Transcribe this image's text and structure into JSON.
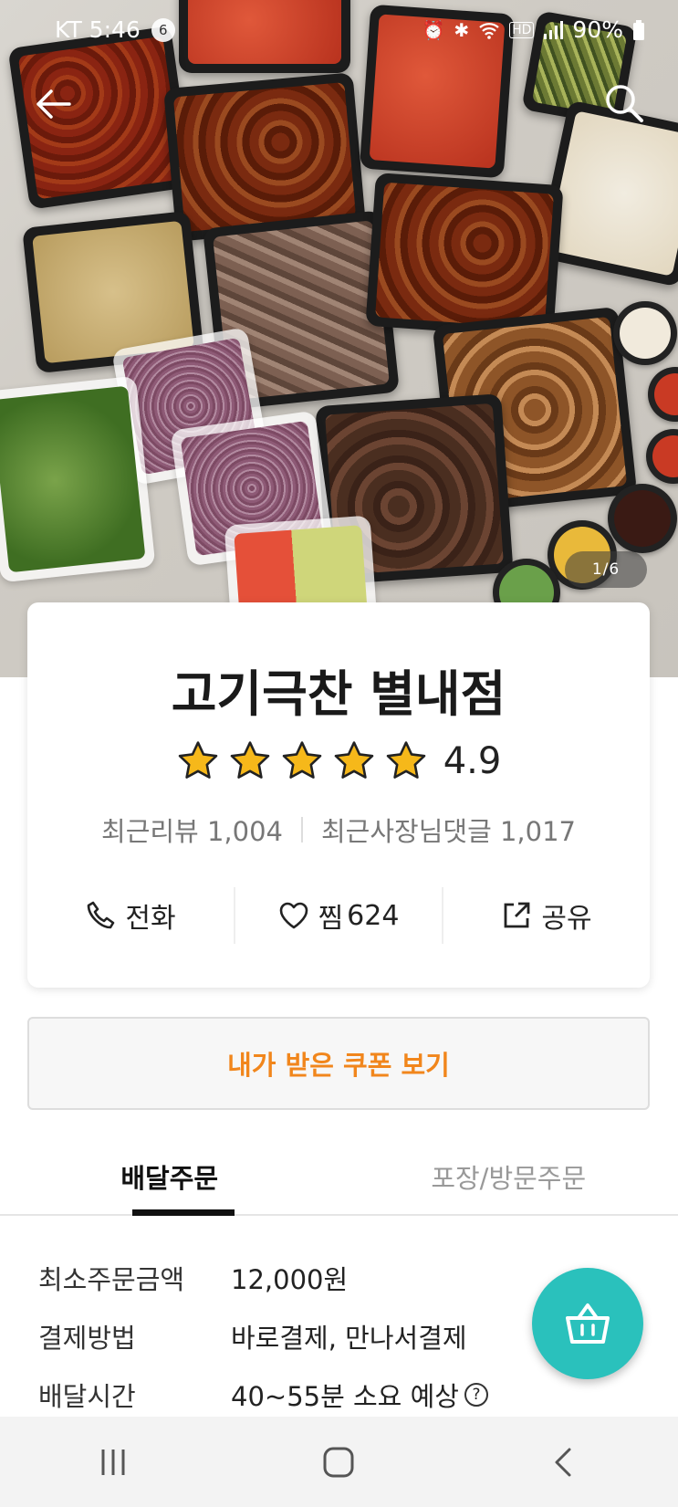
{
  "status_bar": {
    "carrier_time": "KT 5:46",
    "notification_count": "6",
    "icons": [
      "alarm-icon",
      "bluetooth-icon",
      "wifi-icon",
      "hd-icon",
      "signal-icon"
    ],
    "battery": "90%"
  },
  "hero": {
    "image_counter": "1/6"
  },
  "store": {
    "name": "고기극찬 별내점",
    "rating": "4.9",
    "star_count": 5,
    "recent_reviews": "최근리뷰 1,004",
    "recent_owner_replies": "최근사장님댓글 1,017"
  },
  "actions": {
    "call_label": "전화",
    "like_label": "찜",
    "like_count": "624",
    "share_label": "공유"
  },
  "coupon": {
    "label": "내가 받은 쿠폰 보기"
  },
  "tabs": {
    "delivery": "배달주문",
    "pickup": "포장/방문주문"
  },
  "details": {
    "min_order_label": "최소주문금액",
    "min_order_value": "12,000원",
    "payment_label": "결제방법",
    "payment_value": "바로결제, 만나서결제",
    "delivery_time_label": "배달시간",
    "delivery_time_value": "40~55분 소요 예상",
    "help_glyph": "?"
  },
  "colors": {
    "accent_orange": "#f1861c",
    "fab_teal": "#2ac1bc",
    "star_yellow": "#f6b81a"
  }
}
